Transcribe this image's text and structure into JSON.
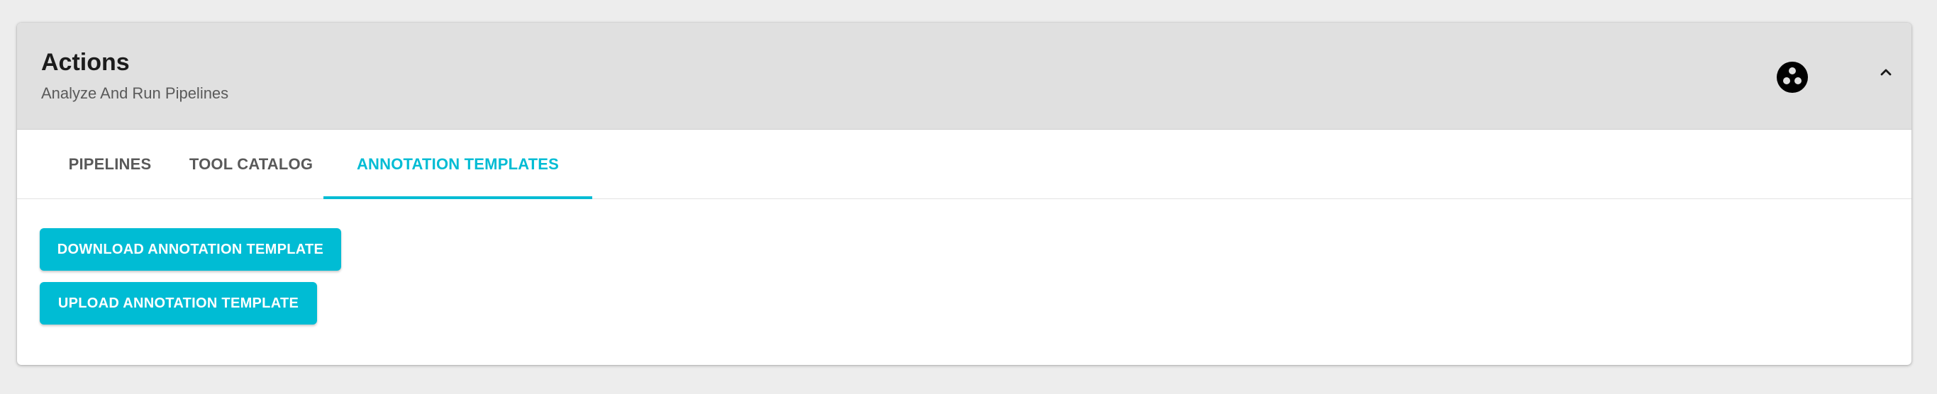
{
  "header": {
    "title": "Actions",
    "subtitle": "Analyze And Run Pipelines",
    "icons": {
      "action_icon": "three-dots-circle-icon",
      "collapse_icon": "chevron-up-icon"
    }
  },
  "tabs": [
    {
      "label": "PIPELINES",
      "active": false
    },
    {
      "label": "TOOL CATALOG",
      "active": false
    },
    {
      "label": "ANNOTATION TEMPLATES",
      "active": true
    }
  ],
  "buttons": {
    "download_label": "DOWNLOAD ANNOTATION TEMPLATE",
    "upload_label": "UPLOAD ANNOTATION TEMPLATE"
  },
  "colors": {
    "accent": "#00bcd4",
    "header_bg": "#e0e0e0",
    "page_bg": "#ededed",
    "tab_inactive": "#595959"
  }
}
